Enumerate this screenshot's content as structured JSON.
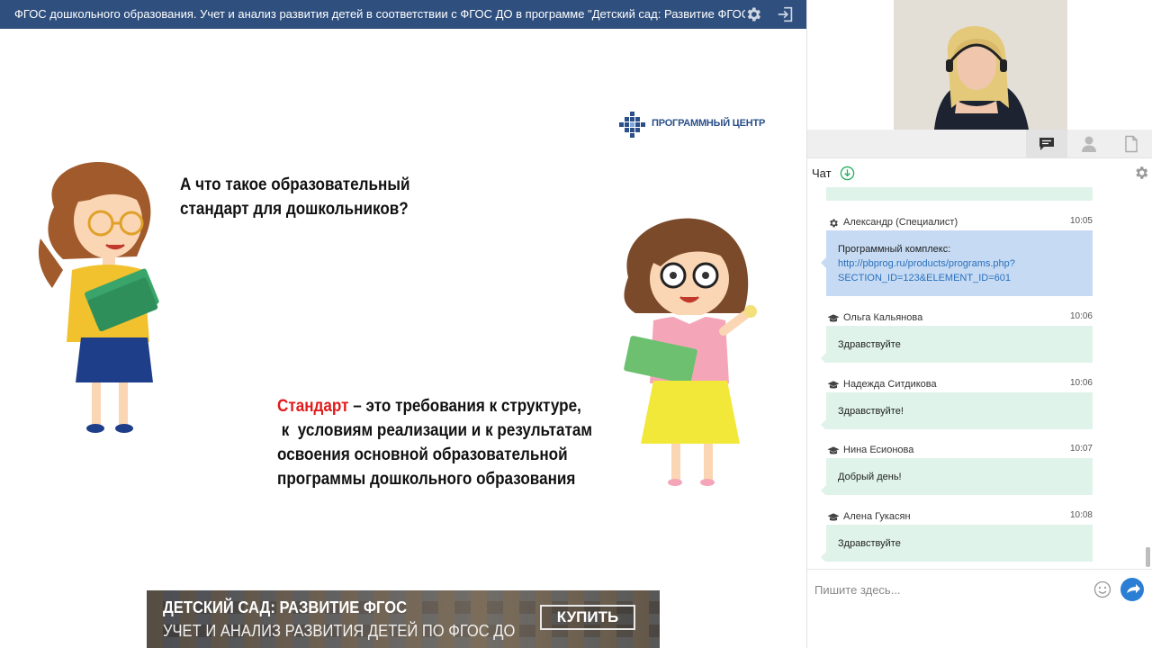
{
  "header": {
    "title": "ФГОС дошкольного образования. Учет и анализ развития детей в соответствии с ФГОС ДО в программе \"Детский сад: Развитие ФГОС\""
  },
  "slide": {
    "logo_text": "ПРОГРАММНЫЙ ЦЕНТР",
    "question_line1": "А что такое образовательный",
    "question_line2": "стандарт для дошкольников?",
    "definition_term": "Стандарт",
    "definition_line1_rest": " – это требования к структуре,",
    "definition_line2": " к  условиям реализации и к результатам",
    "definition_line3": "освоения основной образовательной",
    "definition_line4": "программы дошкольного образования"
  },
  "banner": {
    "line1": "ДЕТСКИЙ САД: РАЗВИТИЕ ФГОС",
    "line2": "УЧЕТ И АНАЛИЗ РАЗВИТИЯ ДЕТЕЙ ПО ФГОС ДО",
    "buy_label": "КУПИТЬ"
  },
  "panel": {
    "tabs": [
      "chat-icon",
      "participants-icon",
      "document-icon"
    ],
    "active_tab": "chat-icon",
    "chat_label": "Чат",
    "messages": [
      {
        "author": "Александр (Специалист)",
        "role_icon": "gear-icon",
        "time": "10:05",
        "style": "blue",
        "text_line1": "Программный комплекс:",
        "link_line1": "http://pbprog.ru/products/programs.php?",
        "link_line2": "SECTION_ID=123&ELEMENT_ID=601"
      },
      {
        "author": "Ольга Кальянова",
        "role_icon": "graduation-cap-icon",
        "time": "10:06",
        "text": "Здравствуйте"
      },
      {
        "author": "Надежда Ситдикова",
        "role_icon": "graduation-cap-icon",
        "time": "10:06",
        "text": "Здравствуйте!"
      },
      {
        "author": "Нина Есионова",
        "role_icon": "graduation-cap-icon",
        "time": "10:07",
        "text": "Добрый день!"
      },
      {
        "author": "Алена Гукасян",
        "role_icon": "graduation-cap-icon",
        "time": "10:08",
        "text": "Здравствуйте"
      }
    ],
    "input_placeholder": "Пишите здесь..."
  },
  "colors": {
    "header_bg": "#2f4f7e",
    "bubble_green": "#dff3ea",
    "bubble_blue": "#c6dbf3",
    "accent_send": "#2a7fd4",
    "term_red": "#e01b1b"
  }
}
